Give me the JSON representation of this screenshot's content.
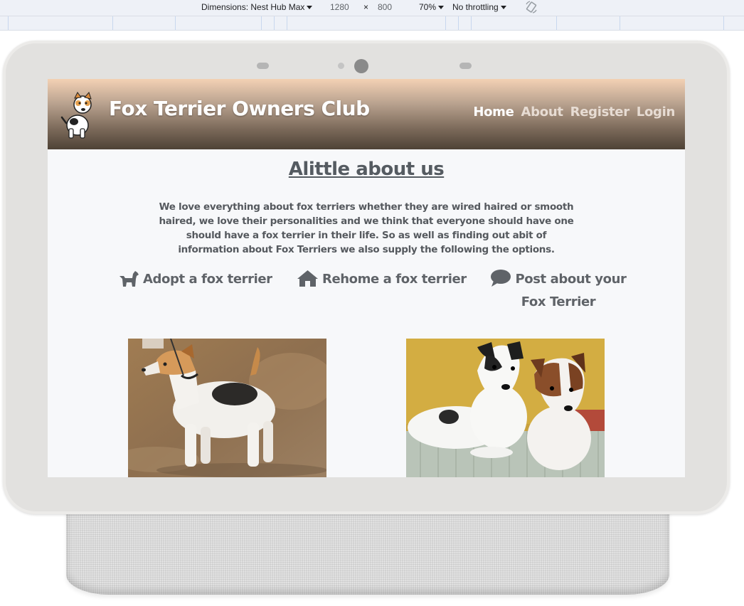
{
  "devtools": {
    "dimensions_label": "Dimensions: Nest Hub Max",
    "width": "1280",
    "times": "×",
    "height": "800",
    "zoom": "70%",
    "throttling": "No throttling"
  },
  "site": {
    "title": "Fox Terrier Owners Club",
    "nav": [
      {
        "label": "Home",
        "active": true
      },
      {
        "label": "About",
        "active": false
      },
      {
        "label": "Register",
        "active": false
      },
      {
        "label": "Login",
        "active": false
      }
    ]
  },
  "about": {
    "heading": "Alittle about us",
    "body": "We love everything about fox terriers whether they are wired haired or smooth haired, we love their personalities and we think that everyone should have one should have a fox terrier in their life. So as well as finding out abit of information about Fox Terriers we also supply the following the options."
  },
  "options": [
    {
      "label": "Adopt a fox terrier",
      "icon": "dog-icon"
    },
    {
      "label": "Rehome a fox terrier",
      "icon": "home-icon"
    },
    {
      "label": "Post about your Fox Terrier",
      "icon": "comment-icon"
    }
  ],
  "colors": {
    "header_top": "#f3d1b4",
    "header_bottom": "#4e4236",
    "text_gray": "#5f6368",
    "page_bg": "#f7f8fa"
  }
}
